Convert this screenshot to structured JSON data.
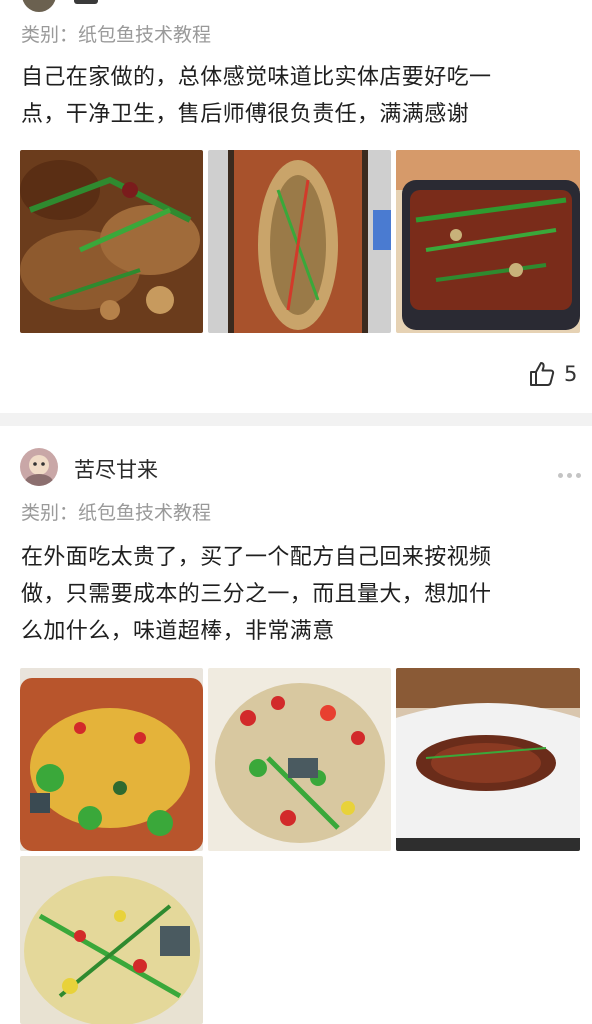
{
  "post1": {
    "category": "类别：纸包鱼技术教程",
    "text_line1": "自己在家做的，总体感觉味道比实体店要好吃一",
    "text_line2": "点，干净卫生，售后师傅很负责任，满满感谢",
    "photos": [
      "food-photo-frog-pot",
      "food-photo-fish-tray",
      "food-photo-griddle"
    ],
    "like_count": "5"
  },
  "post2": {
    "username": "苦尽甘来",
    "category": "类别：纸包鱼技术教程",
    "text_line1": "在外面吃太贵了，买了一个配方自己回来按视频",
    "text_line2": "做，只需要成本的三分之一，而且量大，想加什",
    "text_line3": "么加什么，味道超棒，非常满意",
    "photos": [
      "food-photo-broccoli-fish",
      "food-photo-peppers-fish",
      "food-photo-foil-fish",
      "food-photo-enoki-fish"
    ]
  },
  "icons": {
    "like": "thumbs-up-icon",
    "more": "more-dots-icon"
  }
}
